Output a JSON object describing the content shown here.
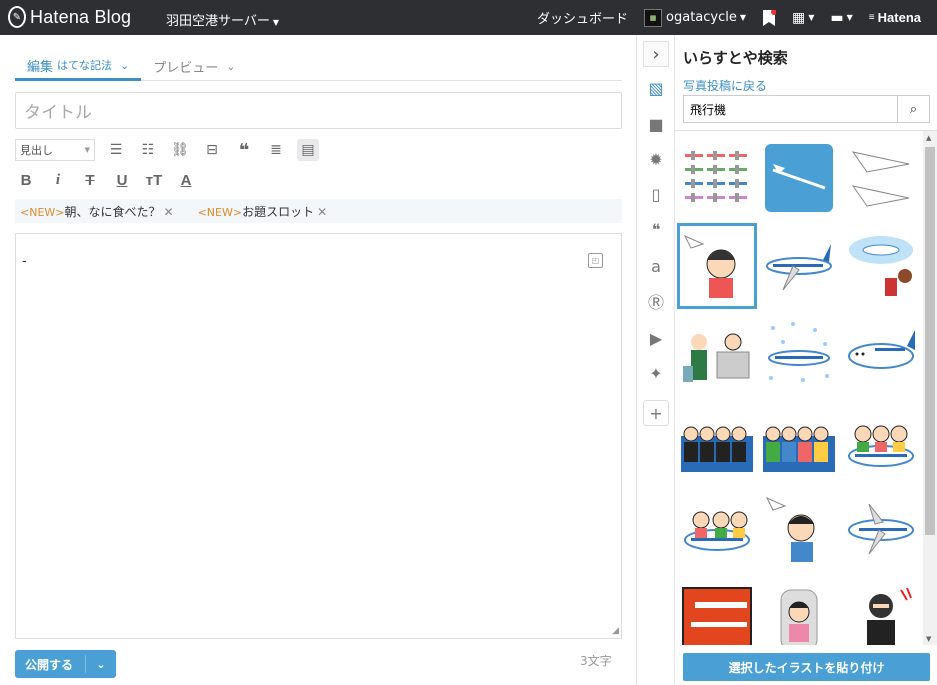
{
  "topbar": {
    "logo_text": "Hatena Blog",
    "blog_name": "羽田空港サーバー",
    "dashboard": "ダッシュボード",
    "username": "ogatacycle",
    "brand": "Hatena"
  },
  "editor": {
    "tabs": [
      {
        "label": "編集",
        "sub": "はてな記法"
      },
      {
        "label": "プレビュー",
        "sub": ""
      }
    ],
    "title_placeholder": "タイトル",
    "heading_select": "見出し",
    "suggestions": [
      {
        "tag": "<NEW>",
        "text": "朝、なに食べた？"
      },
      {
        "tag": "<NEW>",
        "text": "お題スロット"
      }
    ],
    "body_text": "-",
    "publish_label": "公開する",
    "char_count": "3文字"
  },
  "panel": {
    "title": "いらすとや検索",
    "back_link": "写真投稿に戻る",
    "search_value": "飛行機",
    "paste_button": "選択したイラストを貼り付け",
    "selected_index": 3,
    "thumbnails": [
      "airplanes-set",
      "airplane-sky",
      "paper-airplanes",
      "girl-paper-plane",
      "jet-airplane",
      "airplane-travel",
      "airport-checkin",
      "airplane-snow",
      "airplane-face",
      "passengers-1",
      "passengers-2",
      "family-airplane",
      "kids-airplane",
      "boy-paper-plane",
      "airplane-side",
      "flight-recorder",
      "airplane-seat",
      "hijacker"
    ]
  },
  "colors": {
    "accent": "#4a9fd5",
    "topbar": "#2d2f33",
    "new_tag": "#e38a2c"
  }
}
